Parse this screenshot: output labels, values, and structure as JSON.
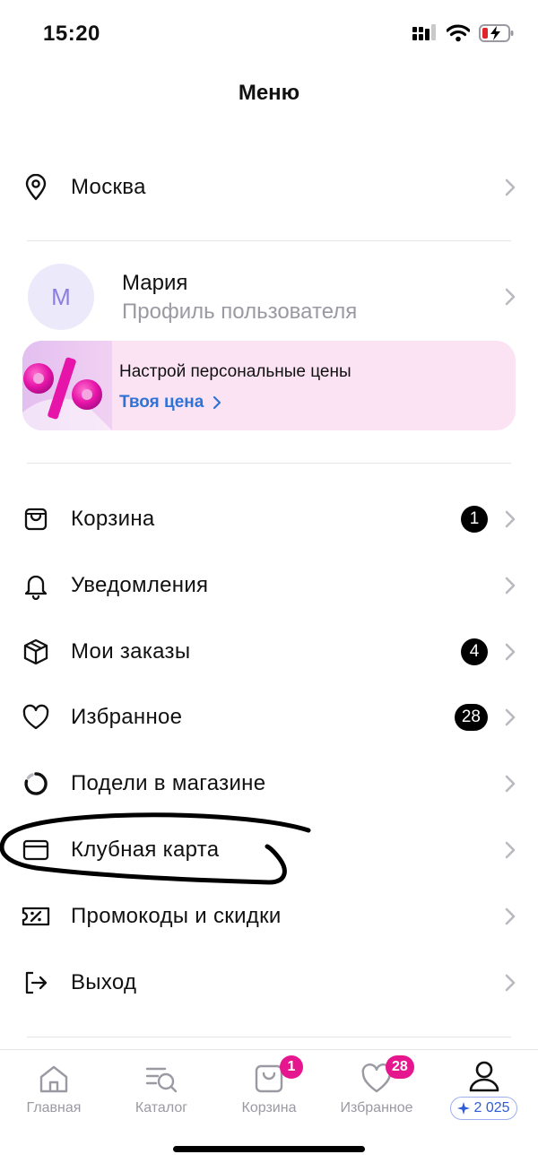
{
  "status": {
    "time": "15:20"
  },
  "header": {
    "title": "Меню"
  },
  "location": {
    "label": "Москва",
    "icon": "location-pin-icon"
  },
  "profile": {
    "avatar_letter": "М",
    "name": "Мария",
    "subtitle": "Профиль пользователя"
  },
  "promo": {
    "title": "Настрой персональные цены",
    "link": "Твоя цена",
    "art": "percent-art"
  },
  "menu": {
    "items": [
      {
        "label": "Корзина",
        "icon": "cart-bag-icon",
        "badge": "1"
      },
      {
        "label": "Уведомления",
        "icon": "bell-icon",
        "badge": ""
      },
      {
        "label": "Мои заказы",
        "icon": "box-icon",
        "badge": "4"
      },
      {
        "label": "Избранное",
        "icon": "heart-icon",
        "badge": "28"
      },
      {
        "label": "Подели в магазине",
        "icon": "split-circle-icon",
        "badge": ""
      },
      {
        "label": "Клубная карта",
        "icon": "card-icon",
        "badge": ""
      },
      {
        "label": "Промокоды и скидки",
        "icon": "promo-ticket-icon",
        "badge": ""
      },
      {
        "label": "Выход",
        "icon": "logout-icon",
        "badge": ""
      }
    ]
  },
  "tabbar": {
    "tabs": [
      {
        "label": "Главная",
        "icon": "home-icon"
      },
      {
        "label": "Каталог",
        "icon": "catalog-search-icon"
      },
      {
        "label": "Корзина",
        "icon": "cart-bag-icon",
        "badge": "1"
      },
      {
        "label": "Избранное",
        "icon": "heart-icon",
        "badge": "28"
      },
      {
        "label": "",
        "icon": "profile-icon"
      }
    ],
    "points": "2 025"
  },
  "colors": {
    "accent_pink": "#e6168f",
    "link_blue": "#2f73d6",
    "promo_bg": "#fbe3f4",
    "avatar_bg": "#ece9fb"
  }
}
